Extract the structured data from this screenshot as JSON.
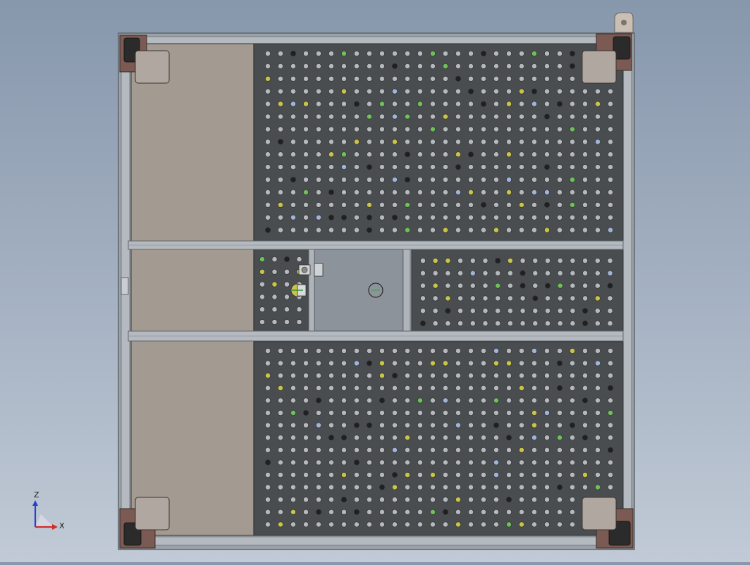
{
  "viewport": {
    "background_top": "#8797ac",
    "background_bottom": "#c1cad6"
  },
  "model": {
    "frame_color": "#9aa1a7",
    "frame_dark": "#5f666c",
    "pegboard_color": "#4a4d50",
    "hole_color": "#b5b8bc",
    "brown_panel_color": "#a39a92",
    "corner_block_color": "#7a5a52",
    "caster_color": "#2b2b2b",
    "pad_color": "#b0a8a0",
    "mount_plate_color": "#8d939a",
    "hole_accent_colors": [
      "#c8c34a",
      "#6fc05a",
      "#9fb4d8"
    ],
    "icons": [
      "caster-wheel-icon",
      "hinge-icon",
      "latch-icon",
      "bolt-icon"
    ]
  },
  "triad": {
    "z_label": "Z",
    "x_label": "X",
    "z_color": "#2a3fd0",
    "x_color": "#d02a2a"
  }
}
